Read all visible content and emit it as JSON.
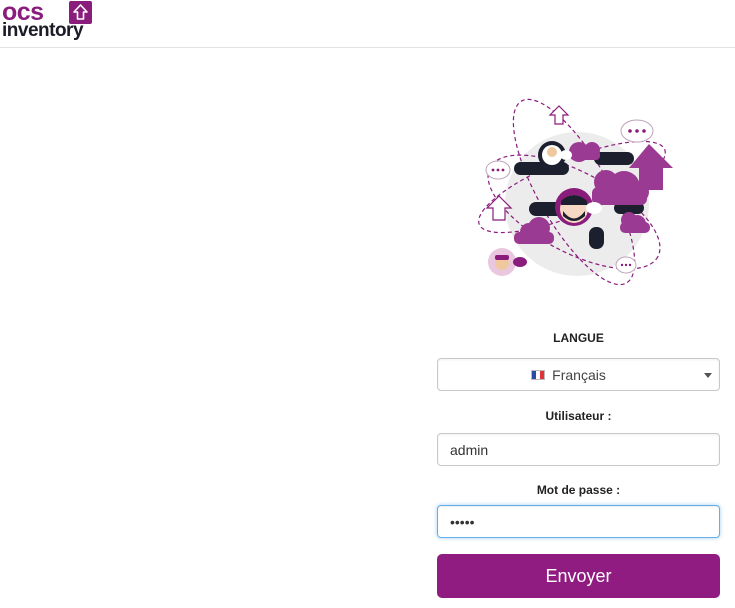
{
  "header": {
    "logo_top": "ocs",
    "logo_bottom": "inventory"
  },
  "colors": {
    "brand": "#911c81",
    "logo_purple": "#8a1c7c",
    "logo_dark": "#1c1c28",
    "focus_border": "#66afe9"
  },
  "illustration": {
    "icon": "collaboration-network-illustration"
  },
  "form": {
    "language": {
      "label": "LANGUE",
      "selected": "Français",
      "flag_icon": "france-flag-icon"
    },
    "user": {
      "label": "Utilisateur :",
      "value": "admin"
    },
    "password": {
      "label": "Mot de passe :",
      "value": "admin"
    },
    "submit_label": "Envoyer"
  }
}
